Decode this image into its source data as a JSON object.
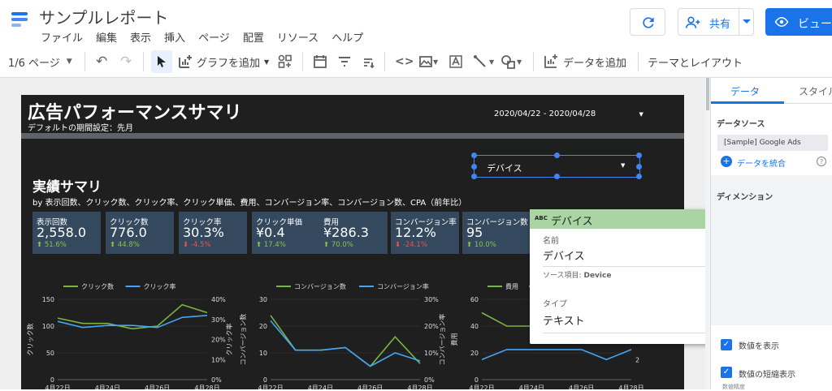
{
  "header": {
    "title": "サンプルレポート",
    "menu": [
      "ファイル",
      "編集",
      "表示",
      "挿入",
      "ページ",
      "配置",
      "リソース",
      "ヘルプ"
    ],
    "share_label": "共有",
    "view_label": "ビュー"
  },
  "toolbar": {
    "page_label": "1/6 ページ",
    "add_chart": "グラフを追加",
    "add_data": "データを追加",
    "theme_layout": "テーマとレイアウト"
  },
  "report": {
    "title": "広告パフォーマンスサマリ",
    "subtitle": "デフォルトの期間設定：先月",
    "date_range": "2020/04/22 - 2020/04/28",
    "device_filter": "デバイス",
    "summary_title": "実績サマリ",
    "summary_sub": "by 表示回数、クリック数、クリック率、クリック単価、費用、コンバージョン率、コンバージョン数、CPA（前年比）"
  },
  "scorecards": [
    {
      "label": "表示回数",
      "value": "2,558.0",
      "delta": "51.6%",
      "dir": "up"
    },
    {
      "label": "クリック数",
      "value": "776.0",
      "delta": "44.8%",
      "dir": "up"
    },
    {
      "label": "クリック率",
      "value": "30.3%",
      "delta": "-4.5%",
      "dir": "down"
    },
    {
      "label": "クリック単価",
      "value": "¥0.4",
      "delta": "17.4%",
      "dir": "up"
    },
    {
      "label": "費用",
      "value": "¥286.3",
      "delta": "70.0%",
      "dir": "up"
    },
    {
      "label": "コンバージョン率",
      "value": "12.2%",
      "delta": "-24.1%",
      "dir": "down"
    },
    {
      "label": "コンバージョン数",
      "value": "95",
      "delta": "10.0%",
      "dir": "up"
    }
  ],
  "chart_data": [
    {
      "type": "line",
      "x": [
        "4月22日",
        "4月23日",
        "4月24日",
        "4月25日",
        "4月26日",
        "4月27日",
        "4月28日"
      ],
      "x_ticks": [
        "4月22日",
        "4月24日",
        "4月26日",
        "4月28日"
      ],
      "series": [
        {
          "name": "クリック数",
          "axis": "left",
          "values": [
            115,
            105,
            105,
            95,
            100,
            140,
            125
          ]
        },
        {
          "name": "クリック率",
          "axis": "right",
          "values": [
            29,
            26,
            27,
            27,
            26,
            31,
            32
          ]
        }
      ],
      "ylabel": "クリック数",
      "y2label": "クリック率",
      "ylim": [
        0,
        150
      ],
      "y_ticks": [
        "0",
        "50",
        "100",
        "150"
      ],
      "y2lim": [
        0,
        40
      ],
      "y2_ticks": [
        "0%",
        "10%",
        "20%",
        "30%",
        "40%"
      ],
      "legend": "top"
    },
    {
      "type": "line",
      "x": [
        "4月22日",
        "4月23日",
        "4月24日",
        "4月25日",
        "4月26日",
        "4月27日",
        "4月28日"
      ],
      "x_ticks": [
        "4月22日",
        "4月24日",
        "4月26日",
        "4月28日"
      ],
      "series": [
        {
          "name": "コンバージョン数",
          "axis": "left",
          "values": [
            24,
            11,
            11,
            12,
            5,
            16,
            6
          ]
        },
        {
          "name": "コンバージョン率",
          "axis": "right",
          "values": [
            22,
            11,
            11,
            12,
            5,
            10,
            7
          ]
        }
      ],
      "ylabel": "コンバージョン数",
      "y2label": "コンバージョン率",
      "ylim": [
        0,
        30
      ],
      "y_ticks": [
        "0",
        "10",
        "20",
        "30"
      ],
      "y2lim": [
        0,
        30
      ],
      "y2_ticks": [
        "0%",
        "10%",
        "20%",
        "30%"
      ],
      "legend": "top"
    },
    {
      "type": "line",
      "x": [
        "4月22日",
        "4月23日",
        "4月24日",
        "4月25日",
        "4月26日",
        "4月27日",
        "4月28日"
      ],
      "x_ticks": [
        "4月22日",
        "4月24日",
        "4月26日",
        "4月28日"
      ],
      "series": [
        {
          "name": "費用",
          "axis": "left",
          "values": [
            50,
            40,
            40,
            45,
            40,
            40,
            45
          ]
        },
        {
          "name": "CPA",
          "axis": "right",
          "values": [
            2,
            3,
            3,
            3,
            3,
            2,
            3
          ]
        }
      ],
      "ylabel": "費用",
      "y2label": "",
      "ylim": [
        0,
        60
      ],
      "y_ticks": [
        "0",
        "20",
        "40",
        "60"
      ],
      "y2lim": [
        0,
        8
      ],
      "y2_ticks": [
        "2",
        "4"
      ],
      "legend": "top"
    }
  ],
  "popup": {
    "header": "デバイス",
    "name_label": "名前",
    "name_value": "デバイス",
    "source_label": "ソース項目:",
    "source_value": "Device",
    "type_label": "タイプ",
    "type_value": "テキスト"
  },
  "side": {
    "tab_data": "データ",
    "tab_style": "スタイル",
    "datasource_label": "データソース",
    "datasource_value": "[Sample] Google Ads",
    "blend_label": "データを統合",
    "dimension_label": "ディメンション",
    "check1": "数値を表示",
    "check2": "数値の短縮表示",
    "check3": "数値精度"
  },
  "colors": {
    "green": "#7cb342",
    "blue": "#42a5f5",
    "accent": "#1a73e8"
  }
}
